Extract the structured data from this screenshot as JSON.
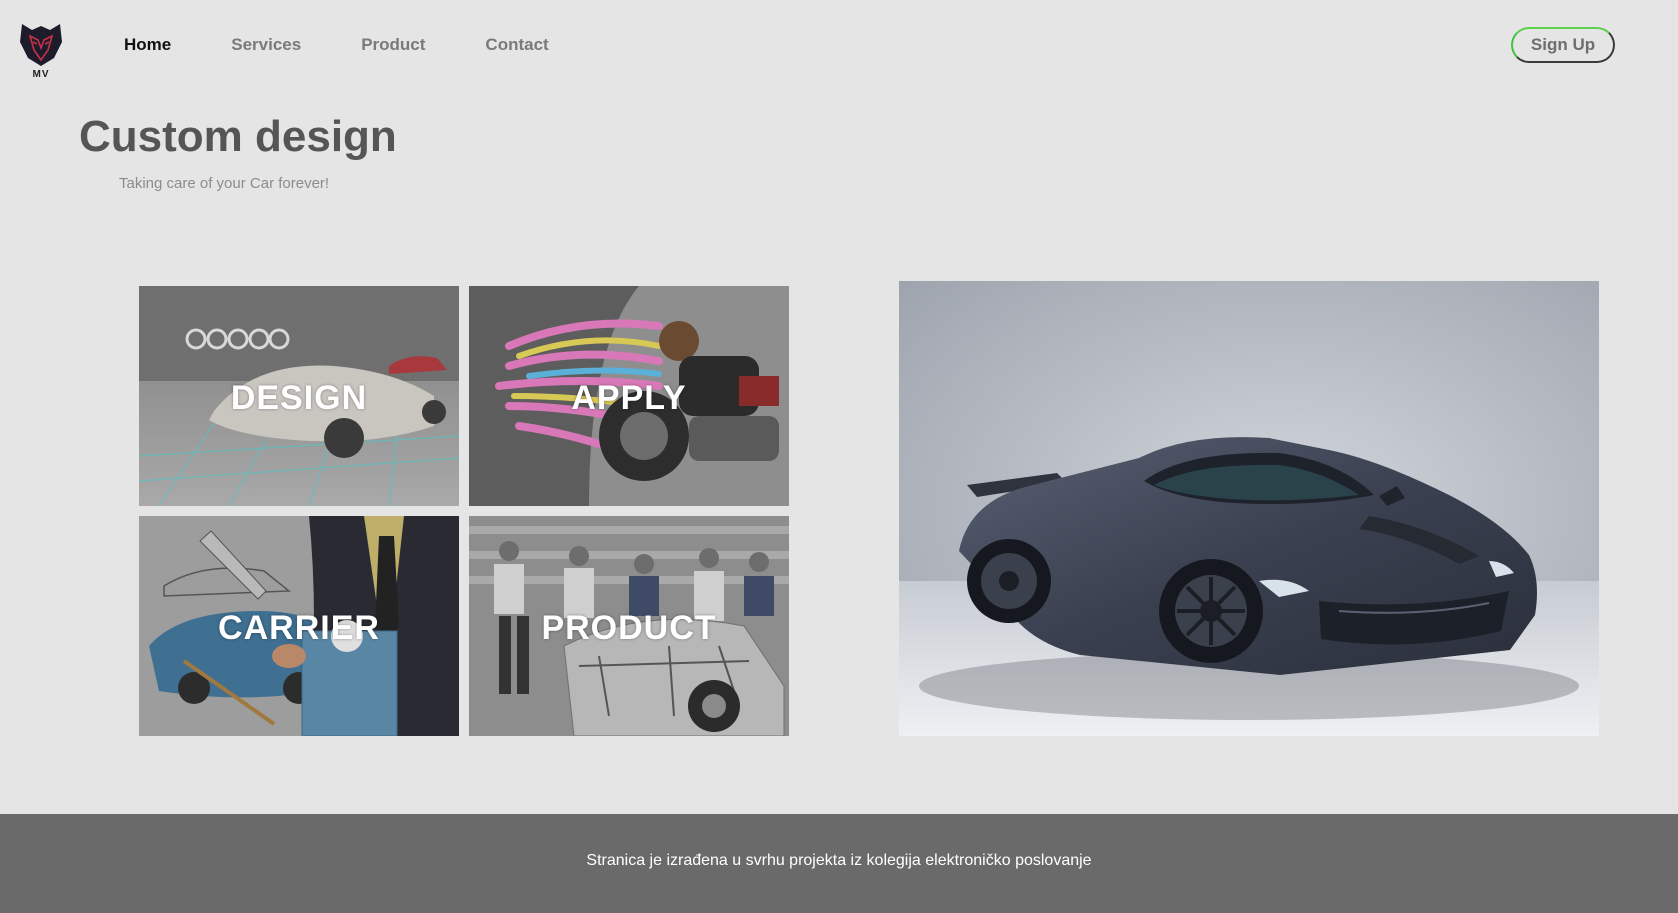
{
  "header": {
    "logo_text": "MV",
    "nav": [
      {
        "label": "Home",
        "active": true
      },
      {
        "label": "Services",
        "active": false
      },
      {
        "label": "Product",
        "active": false
      },
      {
        "label": "Contact",
        "active": false
      }
    ],
    "signup_label": "Sign Up"
  },
  "hero": {
    "title": "Custom design",
    "subtitle": "Taking care of your Car forever!"
  },
  "tiles": [
    {
      "label": "DESIGN"
    },
    {
      "label": "APPLY"
    },
    {
      "label": "CARRIER"
    },
    {
      "label": "PRODUCT"
    }
  ],
  "footer": {
    "text": "Stranica je izrađena u svrhu projekta iz kolegija elektroničko poslovanje"
  },
  "colors": {
    "background": "#e5e5e5",
    "footer": "#6a6a6a",
    "title": "#555555",
    "signup_accent": "#3ec43e"
  }
}
